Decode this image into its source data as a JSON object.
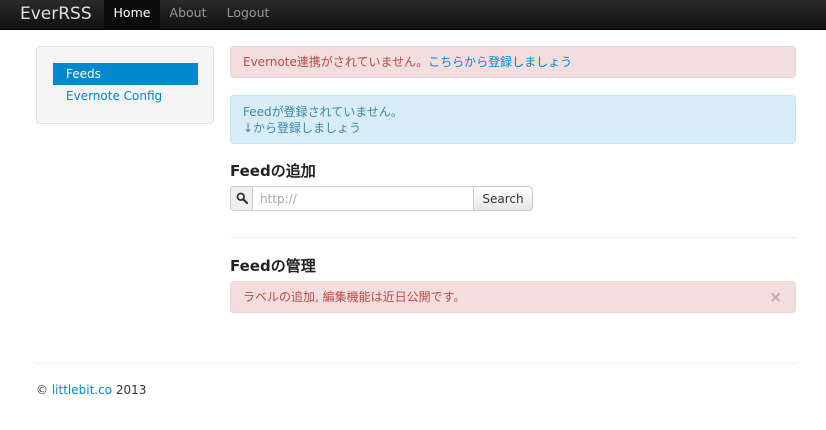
{
  "navbar": {
    "brand": "EverRSS",
    "items": [
      {
        "label": "Home",
        "active": true
      },
      {
        "label": "About",
        "active": false
      },
      {
        "label": "Logout",
        "active": false
      }
    ]
  },
  "sidebar": {
    "items": [
      {
        "label": "Feeds",
        "active": true
      },
      {
        "label": "Evernote Config",
        "active": false
      }
    ]
  },
  "alerts": {
    "evernote": {
      "text": "Evernote連携がされていません。",
      "link": "こちらから登録しましょう"
    },
    "feed": {
      "line1": "Feedが登録されていません。",
      "line2": "↓から登録しましょう"
    },
    "manage": {
      "text": "ラベルの追加, 編集機能は近日公開です。",
      "close": "×"
    }
  },
  "add_feed": {
    "heading": "Feedの追加",
    "search_icon": "search-icon",
    "url_placeholder": "http://",
    "url_value": "",
    "search_button": "Search"
  },
  "manage_feed": {
    "heading": "Feedの管理"
  },
  "footer": {
    "prefix": "©",
    "link": "littlebit.co",
    "year": "2013"
  },
  "colors": {
    "navbar_bg": "#1b1b1b",
    "link": "#0088cc",
    "error_bg": "#f2dede",
    "error_text": "#b94a48",
    "info_bg": "#d9edf7",
    "info_text": "#3a87ad"
  }
}
